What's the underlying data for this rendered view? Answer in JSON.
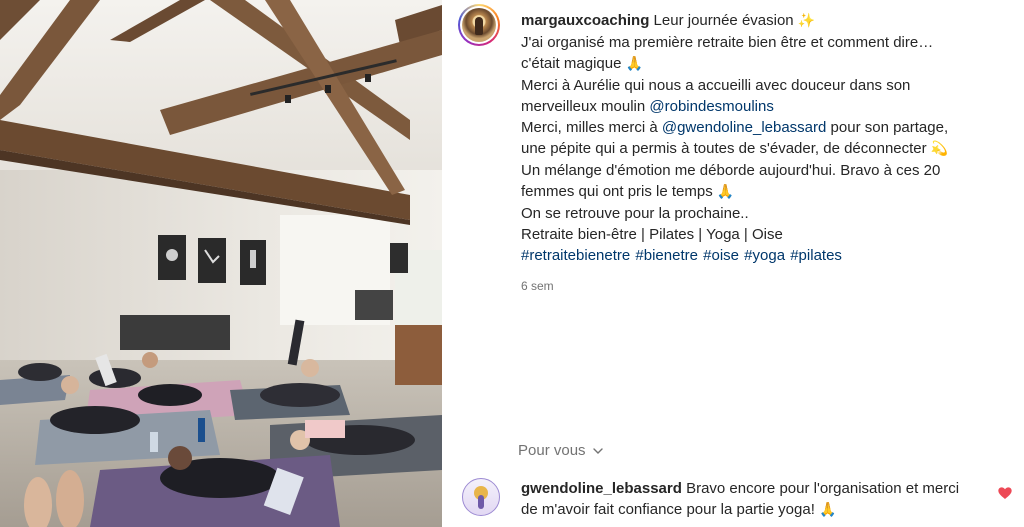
{
  "post": {
    "username": "margauxcoaching",
    "title_text": "Leur journée évasion",
    "title_emoji": "✨",
    "caption": {
      "line1": "J'ai organisé ma première retraite bien être et comment dire…",
      "line2": "c'était magique",
      "line2_emoji": "🙏",
      "line3": "Merci à Aurélie qui nous a accueilli avec douceur dans son",
      "line4_text": "merveilleux moulin",
      "mention1": "@robindesmoulins",
      "line5_text": "Merci, milles merci à",
      "mention2": "@gwendoline_lebassard",
      "line5_after": "pour son partage,",
      "line6": "une pépite qui a permis à toutes de s'évader, de déconnecter",
      "line6_emoji": "💫",
      "line7": "Un mélange d'émotion me déborde aujourd'hui. Bravo à ces 20",
      "line8": "femmes qui ont pris le temps",
      "line8_emoji": "🙏",
      "line9": "On se retrouve pour la prochaine..",
      "line10": "Retraite bien-être | Pilates | Yoga | Oise",
      "hashtags": [
        "#retraitebienetre",
        "#bienetre",
        "#oise",
        "#yoga",
        "#pilates"
      ]
    },
    "time_ago": "6 sem"
  },
  "for_you": {
    "label": "Pour vous"
  },
  "comment": {
    "username": "gwendoline_lebassard",
    "text_line1": "Bravo encore pour l'organisation et",
    "text_line2": "merci de m'avoir fait confiance pour la partie yoga!",
    "emoji": "🙏"
  },
  "icons": {
    "heart": "heart-icon-filled",
    "chevron": "chevron-down-icon"
  },
  "colors": {
    "link": "#00376b",
    "muted": "#737373",
    "heart": "#ed4956"
  }
}
